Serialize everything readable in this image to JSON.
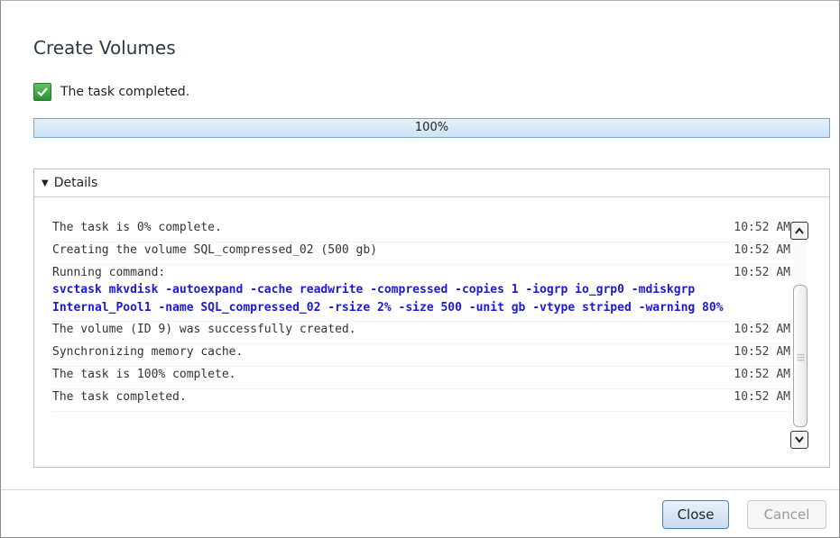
{
  "dialog": {
    "title": "Create Volumes",
    "status_text": "The task completed.",
    "progress": {
      "value": 1.0,
      "label": "100%"
    },
    "details": {
      "header": "Details",
      "rows": [
        {
          "msg": "The task is 0% complete.",
          "time": "10:52 AM"
        },
        {
          "msg": "Creating the volume SQL_compressed_02 (500 gb)",
          "time": "10:52 AM"
        },
        {
          "msg": "Running command:",
          "time": "10:52 AM",
          "command": "svctask mkvdisk -autoexpand -cache readwrite -compressed -copies 1 -iogrp io_grp0 -mdiskgrp Internal_Pool1 -name SQL_compressed_02 -rsize 2% -size 500 -unit gb -vtype striped -warning 80%"
        },
        {
          "msg": "The volume (ID 9) was successfully created.",
          "time": "10:52 AM"
        },
        {
          "msg": "Synchronizing memory cache.",
          "time": "10:52 AM"
        },
        {
          "msg": "The task is 100% complete.",
          "time": "10:52 AM"
        },
        {
          "msg": "The task completed.",
          "time": "10:52 AM"
        }
      ]
    },
    "buttons": {
      "close": "Close",
      "cancel": "Cancel"
    },
    "icons": {
      "status": "check-icon",
      "scroll_up": "chevron-up-icon",
      "scroll_down": "chevron-down-icon",
      "toggle": "triangle-down-icon"
    }
  }
}
